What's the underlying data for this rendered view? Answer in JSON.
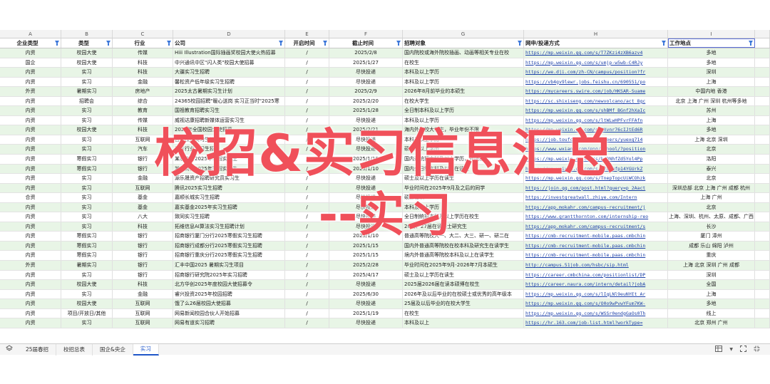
{
  "columns": [
    "A",
    "B",
    "C",
    "D",
    "E",
    "F",
    "G",
    "H",
    "I"
  ],
  "headers": [
    "企业类型",
    "类型",
    "行业",
    "公司",
    "开启时间",
    "截止时间",
    "招聘对象",
    "网申/投递方式",
    "工作地点"
  ],
  "rows": [
    [
      "内资",
      "校园大使",
      "传媒",
      "Hiii Illustration国际插画奖校园大使火热招募",
      "/",
      "2025/2/8",
      "国内院校或海外院校插画、动画等相关专业在校",
      "https://mp.weixin.qq.com/s/T7ZKzi4zXB6azv4",
      "多地"
    ],
    [
      "国企",
      "校园大使",
      "科技",
      "中兴通讯中区\"闪人类\"校园大使招募",
      "/",
      "2025/1/27",
      "在校生",
      "https://mp.weixin.qq.com/s/umjp-w5wb-C4RJy",
      "多地"
    ],
    [
      "内资",
      "实习",
      "科技",
      "大疆实习生招聘",
      "/",
      "尽快投递",
      "本科及以上学历",
      "https://we.dji.com/zh-CN/campus/position?fr",
      "深圳"
    ],
    [
      "内资",
      "实习",
      "金融",
      "馨松资产低年级实习生招聘",
      "/",
      "尽快投递",
      "本科及以上学历",
      "https://vb4gv9lewr.jobs.feishu.cn/690551/po",
      "上海"
    ],
    [
      "外资",
      "暑期实习",
      "房地产",
      "2025太古暑期实习生计划",
      "/",
      "2025/2/9",
      "2026年8月前毕业的本硕生",
      "https://mycareers.swire.com/job/HKSAR-Suame",
      "中国内地 香港"
    ],
    [
      "内资",
      "招聘会",
      "综合",
      "24365校园招聘\"暖心送岗 实习正当时\"2025寒",
      "/",
      "2025/2/20",
      "在校大学生",
      "https://sc.shixiseng.com/newvolcano/act_8gc",
      "北京 上海 广州 深圳 杭州等多地"
    ],
    [
      "内资",
      "实习",
      "教育",
      "国祖教育招聘实习生",
      "/",
      "2025/1/28",
      "全日制本科及以上学历",
      "https://mp.weixin.qq.com/s/shBMf_BGnf2hXaIc",
      "苏州"
    ],
    [
      "内资",
      "实习",
      "传媒",
      "威视达康招聘新媒体运营实习生",
      "/",
      "尽快投递",
      "本科及以上学历",
      "https://mp.weixin.qq.com/s/ltWLwHPFvrFFAfn",
      "上海"
    ],
    [
      "内资",
      "校园大使",
      "科技",
      "2025年全国校园大使招募",
      "/",
      "2025/2/21",
      "海内外在校大学生，毕业年份不限",
      "https://mp.weixin.qq.com/s/GXvnr76cIJtEd6R",
      "多地"
    ],
    [
      "内资",
      "实习",
      "互联网",
      "百度校招实习生招聘",
      "/",
      "尽快投递",
      "本科及以上学历",
      "https://job.toufcoder.com/careers/yuexg714",
      "上海 北京 深圳"
    ],
    [
      "内资",
      "实习",
      "汽车",
      "汽车行业实习生招聘",
      "/",
      "尽快投递",
      "硕士及以上学历",
      "https://www.wxiang.com/eng/school/?position",
      "北京"
    ],
    [
      "内资",
      "寒假实习",
      "银行",
      "某农商行2025年寒假实习生",
      "/",
      "2025/1/15",
      "国内通统招本科及以上学历，外院校",
      "https://mp.weixin.qq.com/s/bgDNhfZd5Yol4Pp",
      "洛阳"
    ],
    [
      "内资",
      "寒假实习",
      "银行",
      "某农商行2025年寒假实习生",
      "/",
      "2025/1/10",
      "国内全日制本科及以上在读生",
      "https://mp.weixin.qq.com/s/4Y8Smfp14YGUrkZ",
      "泰兴"
    ],
    [
      "内资",
      "实习",
      "金融",
      "源乐晟资产招聘研究员实习生",
      "/",
      "尽快投递",
      "硕士及以上学历在读生",
      "https://mp.weixin.qq.com/s/TnepTopcUiWCOhzk",
      "北京"
    ],
    [
      "内资",
      "实习",
      "互联网",
      "腾讯2025实习生招聘",
      "/",
      "尽快投递",
      "毕业时间在2025年9月及之后的同学",
      "https://join.qq.com/post.html?query=p_2Aact",
      "深圳总部 北京 上海 广州 成都 杭州"
    ],
    [
      "合资",
      "实习",
      "基金",
      "嘉顺长城实习生招聘",
      "/",
      "尽快投递",
      "硕士在读",
      "https://investgreatwall.zhiye.com/Intern",
      "上海 广州"
    ],
    [
      "内资",
      "实习",
      "基金",
      "嘉实基金2025年实习生招聘",
      "/",
      "尽快投递",
      "本科及以上学历",
      "https://app.mokahr.com/campus-recruitment/j",
      "北京"
    ],
    [
      "内资",
      "实习",
      "八大",
      "致同实习生招聘",
      "/",
      "尽快投递",
      "全日制统招本科及以上学历在校生",
      "https://www.grantthornton.com/internship-reo",
      "上海、深圳、杭州、太原、成都、广西"
    ],
    [
      "内资",
      "实习",
      "科技",
      "拓维信息AI算法实习生招聘计划",
      "/",
      "尽快投递",
      "26届、27届在读硕士研究生",
      "https://app.mokahr.com/campus-recruitment/s",
      "长沙"
    ],
    [
      "内资",
      "寒假实习",
      "银行",
      "招商银行厦门分行2025寒假实习生招聘",
      "/",
      "2025/1/10",
      "普通高等院校大一、大二、大三、研一、研二在",
      "https://cmb-recruitment-mobile.paas.cmbchin",
      "厦门 漳州"
    ],
    [
      "内资",
      "寒假实习",
      "银行",
      "招商银行成都分行2025寒假实习生招聘",
      "/",
      "2025/1/15",
      "国内外普通高等院校在校本科及研究生在读学生",
      "https://cmb-recruitment-mobile.paas.cmbchin",
      "成都 乐山 绵阳 泸州"
    ],
    [
      "内资",
      "寒假实习",
      "银行",
      "招商银行重庆分行2025寒假实习生招聘",
      "/",
      "2025/1/15",
      "境内外普通高等院校本科及以上在读学生",
      "https://cmb-recruitment-mobile.paas.cmbchin",
      "重庆"
    ],
    [
      "外资",
      "暑期实习",
      "银行",
      "汇丰中国2025 暑期实习生项目",
      "/",
      "2025/2/28",
      "毕业时间在2025年9月-2026年7月本硕生",
      "http://campus.51job.com/hsbc/sip.html",
      "上海 北京 深圳 广州 成都"
    ],
    [
      "内资",
      "实习",
      "银行",
      "招商银行研究院2025年实习招聘",
      "/",
      "2025/4/17",
      "硕士及以上学历在读生",
      "https://career.cmbchina.com/positionlist/DP",
      "深圳"
    ],
    [
      "内资",
      "校园大使",
      "科技",
      "北方华创2025年度校园大使招募令",
      "/",
      "尽快投递",
      "2025届2026届在读本硕博在校生",
      "https://career.naura.com/intern/detail?jobA",
      "全国"
    ],
    [
      "内资",
      "实习",
      "金融",
      "睿兴投资2025年校园招聘",
      "/",
      "2025/6/30",
      "2026年及以后毕业的在校硕士或优秀的高年级本",
      "https://mp.weixin.qq.com/s/lIqLNl9euNYEt_Ar",
      "上海"
    ],
    [
      "内资",
      "校园大使",
      "互联网",
      "饿了么26届校园大使招募",
      "/",
      "尽快投递",
      "25届及以后毕业的在校大学生",
      "https://mp.weixin.qq.com/s/O0o9wPvwYFum7KW-",
      "多地"
    ],
    [
      "内资",
      "项目/开放日/其他",
      "互联网",
      "网易新闻校园合伙人开始招募",
      "/",
      "2025/1/19",
      "在校生",
      "https://mp.weixin.qq.com/s/WSSr0endgGaOs0Th",
      "线上"
    ],
    [
      "内资",
      "实习",
      "互联网",
      "网易有道实习招聘",
      "/",
      "尽快投递",
      "本科及以上",
      "https://hr.163.com/job-list.html?workType=",
      "北京 郑州 广州"
    ]
  ],
  "overlay": {
    "title": "校招&实习信息汇总",
    "subtitle": "--实习"
  },
  "tabs": [
    "25届春招",
    "校招总表",
    "国企&央企",
    "实习"
  ],
  "active_tab": "实习",
  "icons": {
    "sheets": "layers-icon",
    "view": "grid-view-icon",
    "fullscreen": "fullscreen-icon",
    "collapse": "collapse-icon"
  },
  "colors": {
    "overlay": "#f0505a",
    "row_alt": "#e8f5e6",
    "link": "#1b3fa8",
    "filter": "#3c77d9",
    "active_tab": "#1f56c9"
  }
}
